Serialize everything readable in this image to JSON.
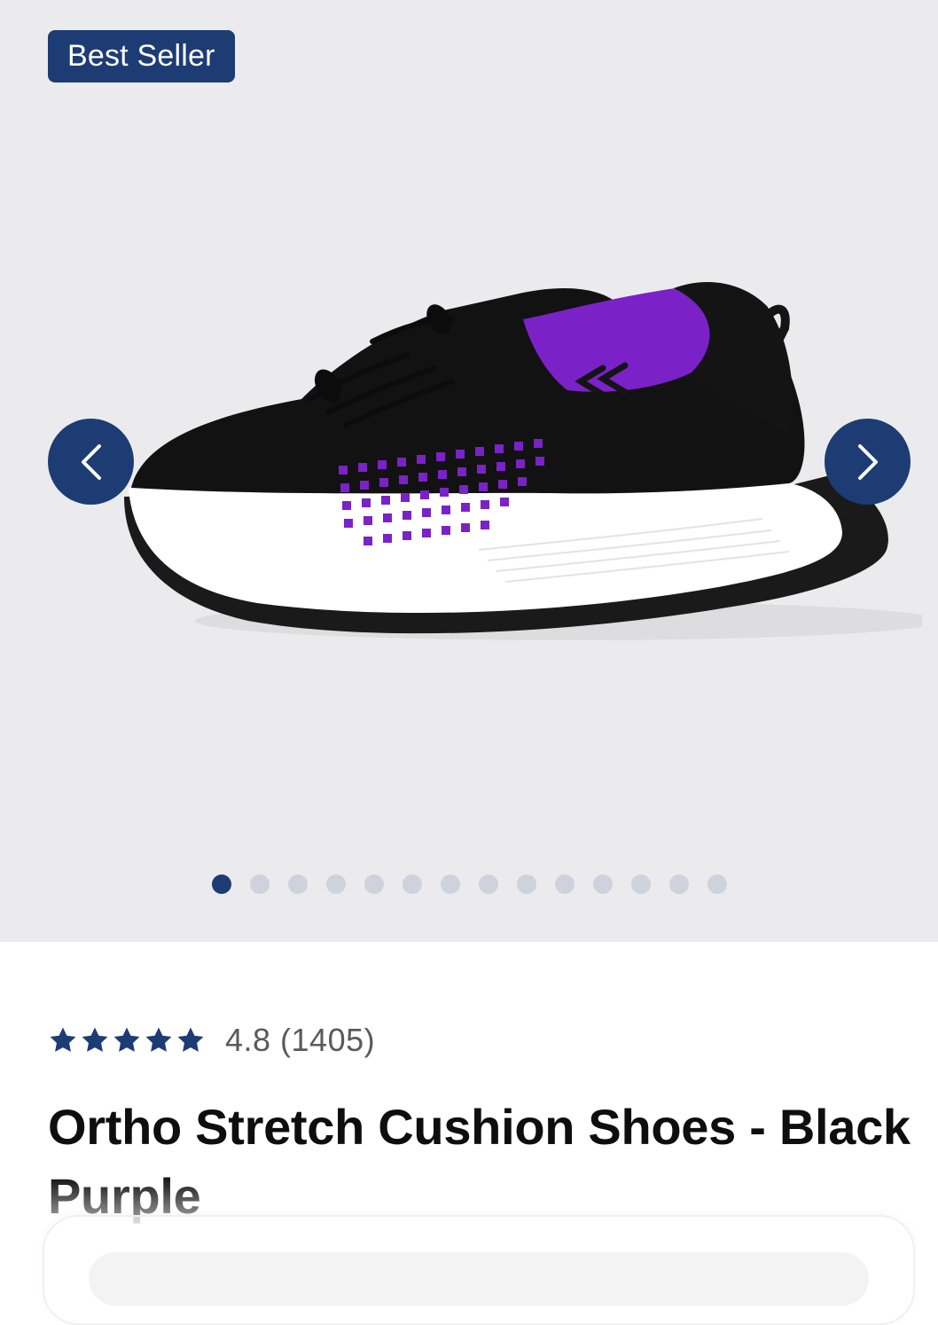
{
  "gallery": {
    "badge": "Best Seller",
    "image_alt": "Black purple knit slip-on cushion shoe",
    "dots_count": 14,
    "active_dot": 0
  },
  "product": {
    "stars": 5,
    "rating_text": "4.8 (1405)",
    "title": "Ortho Stretch Cushion Shoes - Black Purple"
  },
  "colors": {
    "accent": "#1c3c73",
    "gallery_bg": "#ebebed",
    "dot_inactive": "#cdd2dc",
    "shoe_upper": "#111111",
    "shoe_accent": "#7a22c8",
    "sole": "#ffffff"
  },
  "icons": {
    "prev": "chevron-left-icon",
    "next": "chevron-right-icon",
    "star": "star-icon"
  }
}
